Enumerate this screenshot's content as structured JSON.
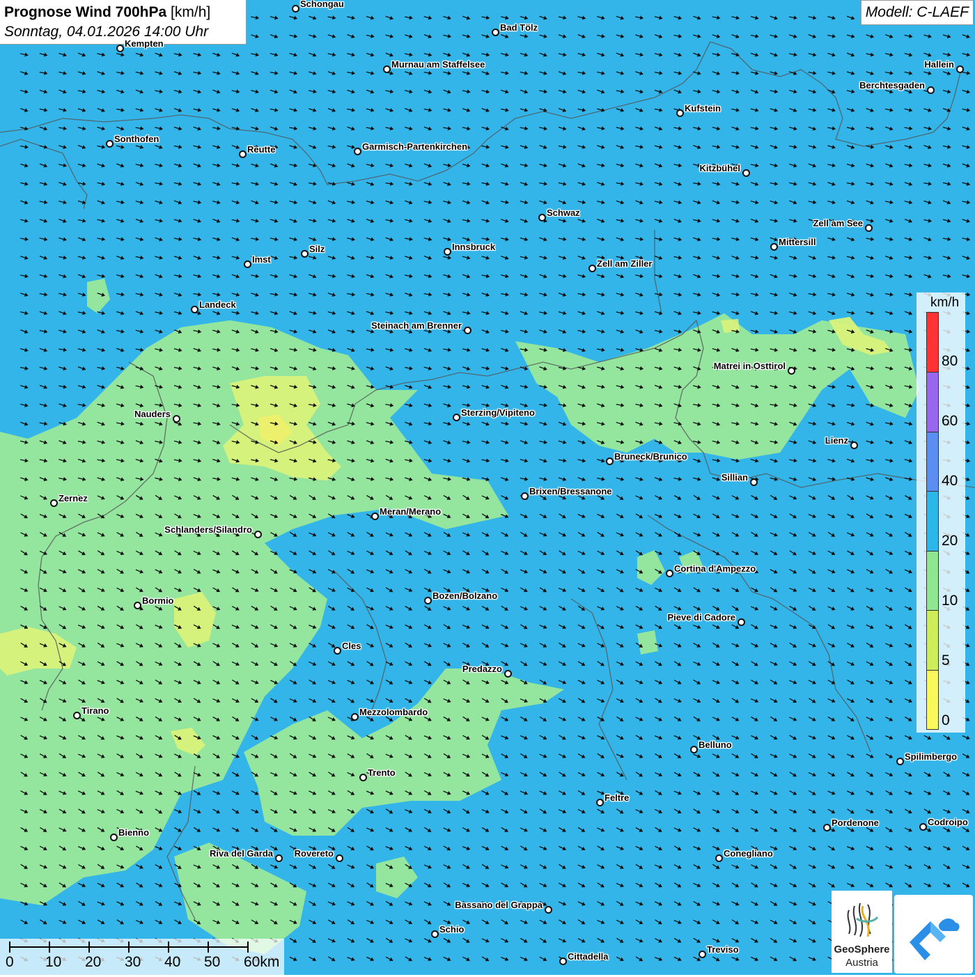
{
  "header": {
    "title_bold": "Prognose Wind 700hPa",
    "title_unit": "[km/h]",
    "subtitle": "Sonntag, 04.01.2026 14:00 Uhr",
    "model": "Modell: C-LAEF"
  },
  "colors": {
    "ocean_blue": "#33b5ea",
    "green": "#9ae89a",
    "yellow_green": "#d8f27a",
    "yellow": "#f6f26a",
    "border_gray": "#555555",
    "wind_arrow": "#111111"
  },
  "legend": {
    "unit": "km/h",
    "ticks": [
      "80",
      "60",
      "40",
      "20",
      "10",
      "5",
      "0"
    ],
    "segments": [
      {
        "color": "#ff3333"
      },
      {
        "color": "#9966ee"
      },
      {
        "color": "#5b8ef0"
      },
      {
        "color": "#2cb7ea"
      },
      {
        "color": "#8fe68f"
      },
      {
        "color": "#cdee58"
      },
      {
        "color": "#f8f85a"
      }
    ]
  },
  "scale_bar": {
    "labels": [
      "0",
      "10",
      "20",
      "30",
      "40",
      "50",
      "60km"
    ]
  },
  "wind": {
    "direction_note": "arrows pointing east-southeast",
    "arrow_icon": "wind-arrow-icon"
  },
  "cities": [
    {
      "name": "Schongau"
    },
    {
      "name": "Bad Tölz"
    },
    {
      "name": "Kempten"
    },
    {
      "name": "Murnau am Staffelsee"
    },
    {
      "name": "Hallein"
    },
    {
      "name": "Berchtesgaden"
    },
    {
      "name": "Kufstein"
    },
    {
      "name": "Sonthofen"
    },
    {
      "name": "Reutte"
    },
    {
      "name": "Garmisch-Partenkirchen"
    },
    {
      "name": "Kitzbühel"
    },
    {
      "name": "Schwaz"
    },
    {
      "name": "Zell am See"
    },
    {
      "name": "Mittersill"
    },
    {
      "name": "Innsbruck"
    },
    {
      "name": "Silz"
    },
    {
      "name": "Imst"
    },
    {
      "name": "Zell am Ziller"
    },
    {
      "name": "Landeck"
    },
    {
      "name": "Steinach am Brenner"
    },
    {
      "name": "Matrei in Osttirol"
    },
    {
      "name": "Nauders"
    },
    {
      "name": "Sterzing/Vipiteno"
    },
    {
      "name": "Lienz"
    },
    {
      "name": "Bruneck/Brunico"
    },
    {
      "name": "Sillian"
    },
    {
      "name": "Zernez"
    },
    {
      "name": "Brixen/Bressanone"
    },
    {
      "name": "Meran/Merano"
    },
    {
      "name": "Schlanders/Silandro"
    },
    {
      "name": "Cortina d'Ampezzo"
    },
    {
      "name": "Bozen/Bolzano"
    },
    {
      "name": "Bormio"
    },
    {
      "name": "Pieve di Cadore"
    },
    {
      "name": "Cles"
    },
    {
      "name": "Predazzo"
    },
    {
      "name": "Tirano"
    },
    {
      "name": "Mezzolombardo"
    },
    {
      "name": "Belluno"
    },
    {
      "name": "Spilimbergo"
    },
    {
      "name": "Trento"
    },
    {
      "name": "Feltre"
    },
    {
      "name": "Bienno"
    },
    {
      "name": "Pordenone"
    },
    {
      "name": "Codroipo"
    },
    {
      "name": "Riva del Garda"
    },
    {
      "name": "Rovereto"
    },
    {
      "name": "Conegliano"
    },
    {
      "name": "Bassano del Grappa"
    },
    {
      "name": "Schio"
    },
    {
      "name": "Treviso"
    },
    {
      "name": "Cittadella"
    }
  ],
  "logos": {
    "geosphere_line1": "GeoSphere",
    "geosphere_line2": "Austria"
  }
}
